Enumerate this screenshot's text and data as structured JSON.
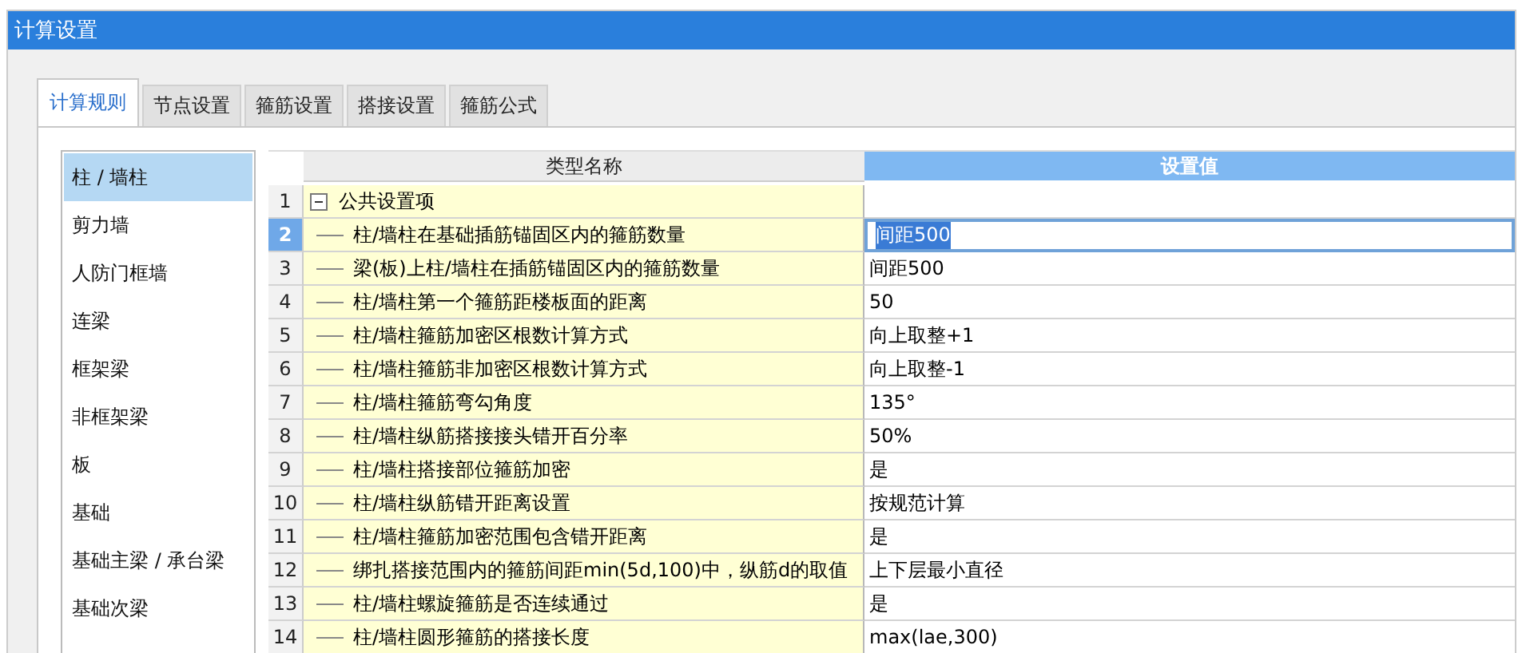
{
  "window": {
    "title": "计算设置"
  },
  "tabs": [
    {
      "label": "计算规则",
      "selected": true
    },
    {
      "label": "节点设置",
      "selected": false
    },
    {
      "label": "箍筋设置",
      "selected": false
    },
    {
      "label": "搭接设置",
      "selected": false
    },
    {
      "label": "箍筋公式",
      "selected": false
    }
  ],
  "sidebar": {
    "items": [
      {
        "label": "柱 / 墙柱",
        "selected": true
      },
      {
        "label": "剪力墙",
        "selected": false
      },
      {
        "label": "人防门框墙",
        "selected": false
      },
      {
        "label": "连梁",
        "selected": false
      },
      {
        "label": "框架梁",
        "selected": false
      },
      {
        "label": "非框架梁",
        "selected": false
      },
      {
        "label": "板",
        "selected": false
      },
      {
        "label": "基础",
        "selected": false
      },
      {
        "label": "基础主梁 / 承台梁",
        "selected": false
      },
      {
        "label": "基础次梁",
        "selected": false
      }
    ]
  },
  "table": {
    "columns": [
      "类型名称",
      "设置值"
    ],
    "rows": [
      {
        "number": "1",
        "name": "公共设置项",
        "kind": "group",
        "expanded": true,
        "selected": false
      },
      {
        "number": "2",
        "name": "柱/墙柱在基础插筋锚固区内的箍筋数量",
        "value": "间距500",
        "kind": "item",
        "selected": true
      },
      {
        "number": "3",
        "name": "梁(板)上柱/墙柱在插筋锚固区内的箍筋数量",
        "value": "间距500",
        "kind": "item",
        "selected": false
      },
      {
        "number": "4",
        "name": "柱/墙柱第一个箍筋距楼板面的距离",
        "value": "50",
        "kind": "item",
        "selected": false
      },
      {
        "number": "5",
        "name": "柱/墙柱箍筋加密区根数计算方式",
        "value": "向上取整+1",
        "kind": "item",
        "selected": false
      },
      {
        "number": "6",
        "name": "柱/墙柱箍筋非加密区根数计算方式",
        "value": "向上取整-1",
        "kind": "item",
        "selected": false
      },
      {
        "number": "7",
        "name": "柱/墙柱箍筋弯勾角度",
        "value": "135°",
        "kind": "item",
        "selected": false
      },
      {
        "number": "8",
        "name": "柱/墙柱纵筋搭接接头错开百分率",
        "value": "50%",
        "kind": "item",
        "selected": false
      },
      {
        "number": "9",
        "name": "柱/墙柱搭接部位箍筋加密",
        "value": "是",
        "kind": "item",
        "selected": false
      },
      {
        "number": "10",
        "name": "柱/墙柱纵筋错开距离设置",
        "value": "按规范计算",
        "kind": "item",
        "selected": false
      },
      {
        "number": "11",
        "name": "柱/墙柱箍筋加密范围包含错开距离",
        "value": "是",
        "kind": "item",
        "selected": false
      },
      {
        "number": "12",
        "name": "绑扎搭接范围内的箍筋间距min(5d,100)中，纵筋d的取值",
        "value": "上下层最小直径",
        "kind": "item",
        "selected": false
      },
      {
        "number": "13",
        "name": "柱/墙柱螺旋箍筋是否连续通过",
        "value": "是",
        "kind": "item",
        "selected": false
      },
      {
        "number": "14",
        "name": "柱/墙柱圆形箍筋的搭接长度",
        "value": "max(lae,300)",
        "kind": "item",
        "selected": false
      }
    ]
  }
}
